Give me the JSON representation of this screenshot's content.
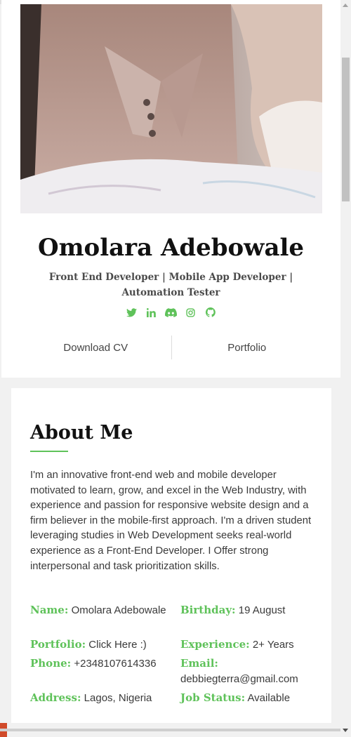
{
  "profile": {
    "name": "Omolara Adebowale",
    "roles": "Front End Developer | Mobile App Developer | Automation Tester",
    "photo_alt": "profile-photo",
    "social_icons": [
      "twitter-icon",
      "linkedin-icon",
      "discord-icon",
      "instagram-icon",
      "github-icon"
    ],
    "accent_color": "#5fc25a",
    "actions": {
      "download_cv": "Download CV",
      "portfolio": "Portfolio"
    }
  },
  "about": {
    "title": "About Me",
    "text": "I'm an innovative front-end web and mobile developer motivated to learn, grow, and excel in the Web Industry, with experience and passion for responsive website design and a firm believer in the mobile-first approach. I'm a driven student leveraging studies in Web Development seeks real-world experience as a Front-End Developer. I Offer strong interpersonal and task prioritization skills.",
    "info": {
      "name": {
        "label": "Name:",
        "value": "Omolara Adebowale"
      },
      "birthday": {
        "label": "Birthday:",
        "value": "19 August"
      },
      "portfolio": {
        "label": "Portfolio:",
        "value": "Click Here :)"
      },
      "experience": {
        "label": "Experience:",
        "value": "2+ Years"
      },
      "phone": {
        "label": "Phone:",
        "value": "+2348107614336"
      },
      "email": {
        "label": "Email:",
        "value": "debbiegterra@gmail.com"
      },
      "address": {
        "label": "Address:",
        "value": "Lagos, Nigeria"
      },
      "job_status": {
        "label": "Job Status:",
        "value": "Available"
      }
    }
  }
}
